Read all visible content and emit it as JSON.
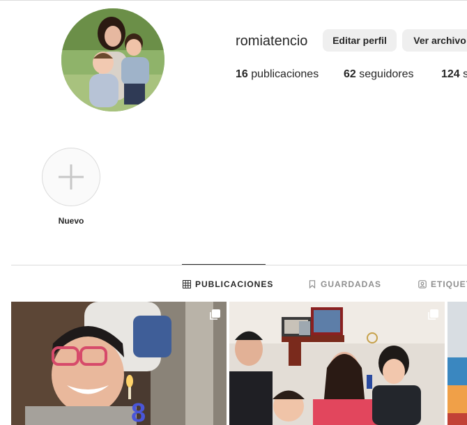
{
  "profile": {
    "username": "romiatencio",
    "edit_button": "Editar perfil",
    "archive_button": "Ver archivo",
    "stats": {
      "posts_count": "16",
      "posts_label": "publicaciones",
      "followers_count": "62",
      "followers_label": "seguidores",
      "following_count": "124",
      "following_label": "se"
    }
  },
  "highlights": [
    {
      "label": "Nuevo",
      "icon": "plus-icon"
    }
  ],
  "tabs": [
    {
      "label": "PUBLICACIONES",
      "icon": "grid-icon",
      "active": true
    },
    {
      "label": "GUARDADAS",
      "icon": "bookmark-icon",
      "active": false
    },
    {
      "label": "ETIQUET",
      "icon": "tagged-icon",
      "active": false
    }
  ],
  "posts": [
    {
      "type": "multiple",
      "icon": "multiple-photos-icon"
    },
    {
      "type": "multiple",
      "icon": "multiple-photos-icon"
    },
    {
      "type": "single"
    }
  ],
  "colors": {
    "text": "#262626",
    "muted": "#8e8e8e",
    "button_bg": "#efefef",
    "border": "#dbdbdb"
  }
}
